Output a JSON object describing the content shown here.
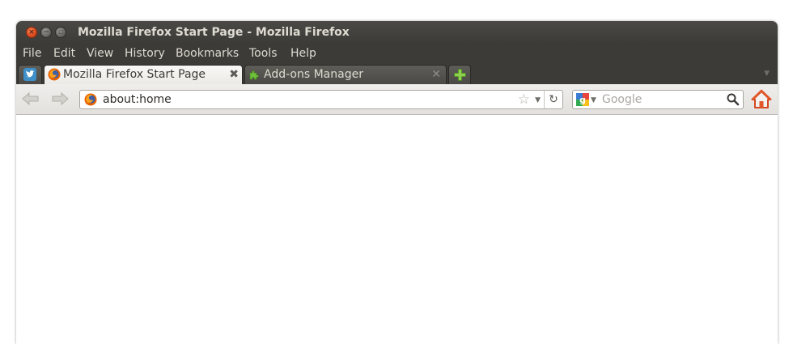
{
  "window": {
    "title": "Mozilla Firefox Start Page - Mozilla Firefox"
  },
  "menu": {
    "items": [
      {
        "label": "File"
      },
      {
        "label": "Edit"
      },
      {
        "label": "View"
      },
      {
        "label": "History"
      },
      {
        "label": "Bookmarks"
      },
      {
        "label": "Tools"
      },
      {
        "label": "Help"
      }
    ]
  },
  "tabs": [
    {
      "label": "",
      "icon": "twitter-bird-icon",
      "pinned": true,
      "active": false
    },
    {
      "label": "Mozilla Firefox Start Page",
      "icon": "firefox-icon",
      "active": true,
      "close_glyph": "✖"
    },
    {
      "label": "Add-ons Manager",
      "icon": "puzzle-piece-icon",
      "active": false,
      "close_glyph": "✕"
    }
  ],
  "new_tab": {
    "glyph": "+",
    "icon": "plus-icon"
  },
  "navbar": {
    "url": "about:home",
    "search_placeholder": "Google",
    "search_engine_icon": "google-icon"
  },
  "colors": {
    "title_bar": "#3c3b37",
    "title_text": "#dfdbd2",
    "close_button": "#e2572a",
    "active_tab": "#f3f2f0",
    "toolbar": "#e9e7e3"
  }
}
